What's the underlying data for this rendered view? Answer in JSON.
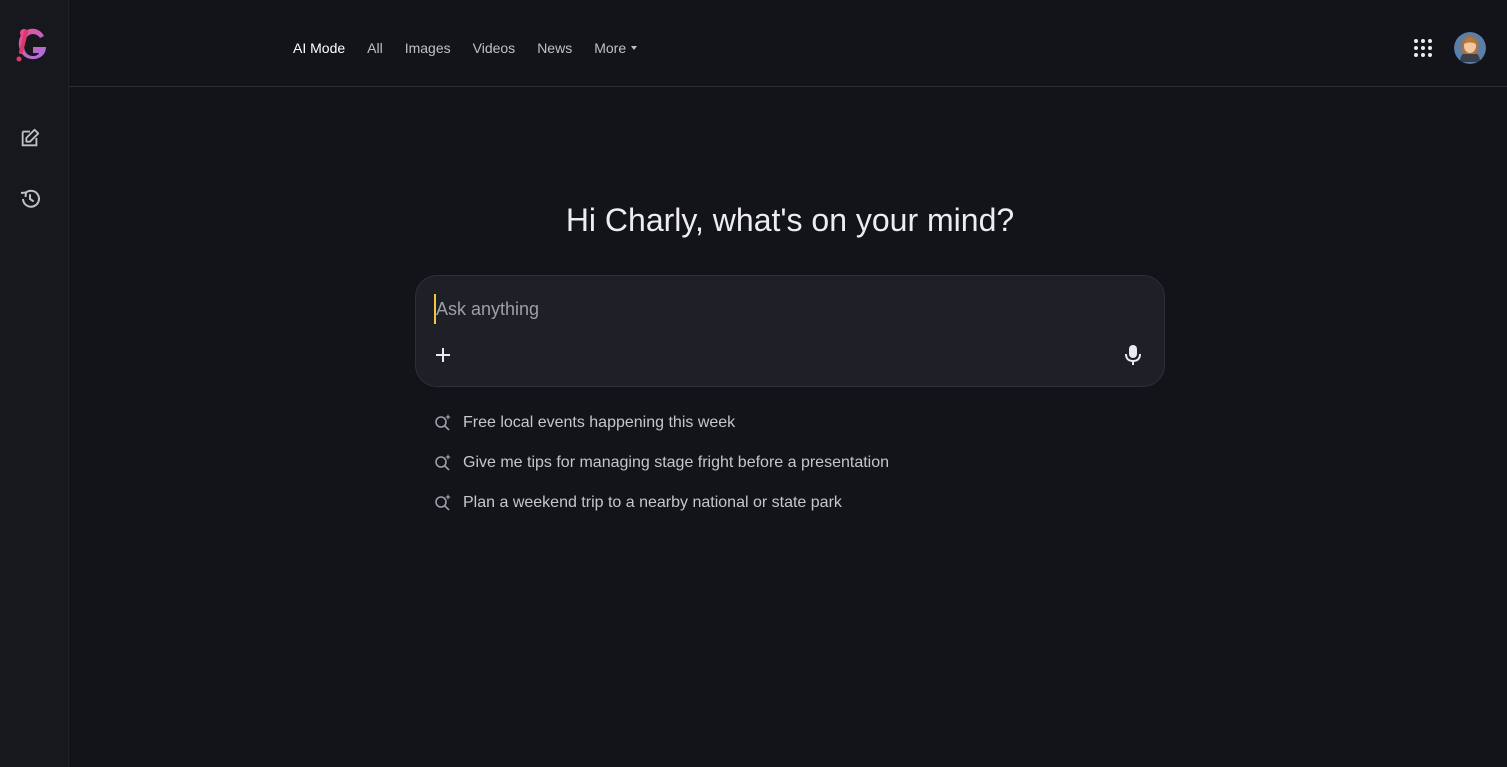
{
  "nav": {
    "tabs": [
      {
        "label": "AI Mode",
        "active": true
      },
      {
        "label": "All"
      },
      {
        "label": "Images"
      },
      {
        "label": "Videos"
      },
      {
        "label": "News"
      },
      {
        "label": "More"
      }
    ]
  },
  "sidebar": {
    "icons": [
      "new-chat-icon",
      "history-icon"
    ]
  },
  "main": {
    "greeting": "Hi Charly, what's on your mind?",
    "search": {
      "placeholder": "Ask anything",
      "value": ""
    },
    "suggestions": [
      {
        "label": "Free local events happening this week"
      },
      {
        "label": "Give me tips for managing stage fright before a presentation"
      },
      {
        "label": "Plan a weekend trip to a nearby national or state park"
      }
    ]
  },
  "colors": {
    "background": "#131419",
    "sidebar": "#17181d",
    "searchbox": "#1f2027",
    "caret": "#f5c542",
    "text": "#e8eaed"
  }
}
